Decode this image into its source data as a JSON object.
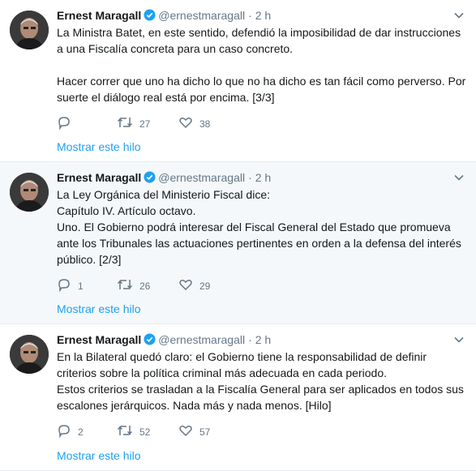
{
  "tweets": [
    {
      "name": "Ernest Maragall",
      "handle": "@ernestmaragall",
      "separator": "·",
      "time": "2 h",
      "text": "La Ministra Batet, en este sentido, defendió la imposibilidad de dar instrucciones a una Fiscalía concreta para un caso concreto.\n\nHacer correr que uno ha dicho lo que no ha dicho es tan fácil como perverso. Por suerte el diálogo real está por encima. [3/3]",
      "replies": "",
      "retweets": "27",
      "likes": "38",
      "show_thread": "Mostrar este hilo"
    },
    {
      "name": "Ernest Maragall",
      "handle": "@ernestmaragall",
      "separator": "·",
      "time": "2 h",
      "text": "La Ley Orgánica del Ministerio Fiscal dice:\nCapítulo IV. Artículo octavo.\nUno. El Gobierno podrá interesar del Fiscal General del Estado que promueva ante los Tribunales las actuaciones pertinentes en orden a la defensa del interés público. [2/3]",
      "replies": "1",
      "retweets": "26",
      "likes": "29",
      "show_thread": "Mostrar este hilo"
    },
    {
      "name": "Ernest Maragall",
      "handle": "@ernestmaragall",
      "separator": "·",
      "time": "2 h",
      "text": "En la Bilateral quedó claro: el Gobierno tiene la responsabilidad de definir criterios sobre la política criminal más adecuada en cada periodo.\nEstos criterios se trasladan a la Fiscalía General para ser aplicados en todos sus escalones jerárquicos. Nada más y nada menos. [Hilo]",
      "replies": "2",
      "retweets": "52",
      "likes": "57",
      "show_thread": "Mostrar este hilo"
    }
  ],
  "colors": {
    "link": "#1da1f2",
    "secondary_text": "#657786",
    "highlight_bg": "#f5f8fa",
    "verified": "#1da1f2"
  },
  "icons": {
    "verified": "verified-badge-icon",
    "caret": "chevron-down-icon",
    "reply": "reply-icon",
    "retweet": "retweet-icon",
    "like": "heart-icon"
  }
}
